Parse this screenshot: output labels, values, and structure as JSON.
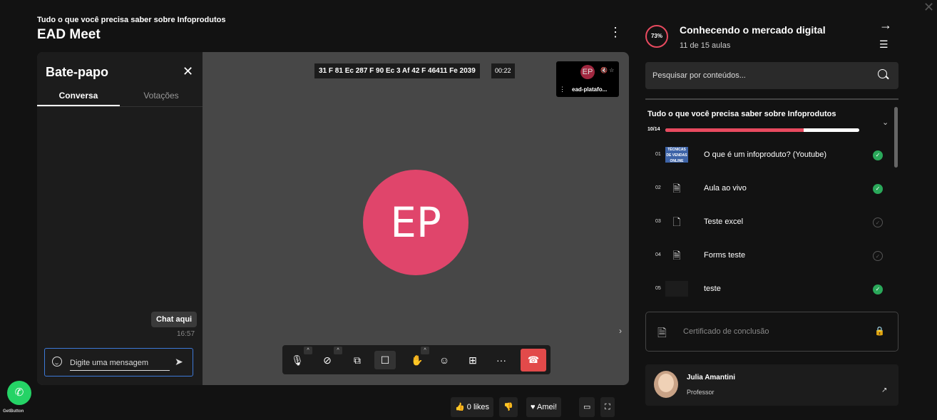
{
  "header": {
    "course_name": "Tudo o que você precisa saber sobre Infoprodutos",
    "page_title": "EAD Meet",
    "more_icon": "⋮"
  },
  "chat": {
    "title": "Bate-papo",
    "close_icon": "✕",
    "tabs": [
      {
        "label": "Conversa"
      },
      {
        "label": "Votações"
      }
    ],
    "message": {
      "text": "Chat aqui",
      "time": "16:57"
    },
    "input_placeholder": "Digite uma mensagem",
    "send_icon": "➤"
  },
  "meeting": {
    "recording_id": "31 F 81 Ec 287 F 90 Ec 3 Af 42 F 46411 Fe 2039",
    "elapsed": "00:22",
    "thumbnail": {
      "initials": "EP",
      "name": "ead-platafo..."
    },
    "main_avatar_initials": "EP",
    "side_arrow": "›",
    "toolbar": {
      "mic_icon": "🎙",
      "camera_icon": "⊘",
      "share_icon": "⧉",
      "chat_icon": "☐",
      "hand_icon": "✋",
      "participants_icon": "☺",
      "tiles_icon": "⊞",
      "more_icon": "···",
      "hangup_icon": "☎",
      "caret": "^"
    }
  },
  "actions": {
    "likes": "0 likes",
    "like_icon": "👍",
    "dislike_icon": "👎",
    "love": "Amei!",
    "love_icon": "♥",
    "theater_icon": "▭",
    "fullscreen_icon": "⛶"
  },
  "course_panel": {
    "progress_percent": "73%",
    "progress_value": 73,
    "title": "Conhecendo o mercado digital",
    "lessons_count": "11 de 15 aulas",
    "next_icon": "→",
    "filter_icon": "☰",
    "search_placeholder": "Pesquisar por conteúdos...",
    "module": {
      "title": "Tudo o que você precisa saber sobre Infoprodutos",
      "progress_label": "10/14",
      "progress_fraction": 0.714,
      "chevron": "⌄"
    },
    "lessons": [
      {
        "num": "01",
        "label": "O que é um infoproduto? (Youtube)",
        "type": "video",
        "thumb_text": "TÉCNICAS DE VENDAS ONLINE",
        "duration": "03:50",
        "done": true
      },
      {
        "num": "02",
        "label": "Aula ao vivo",
        "type": "doc",
        "done": true
      },
      {
        "num": "03",
        "label": "Teste excel",
        "type": "pdf",
        "done": false
      },
      {
        "num": "04",
        "label": "Forms teste",
        "type": "doc",
        "done": false
      },
      {
        "num": "05",
        "label": "teste",
        "type": "blank",
        "done": true
      }
    ],
    "certificate": {
      "label": "Certificado de conclusão",
      "icon": "🗎",
      "lock_icon": "🔒"
    },
    "professor": {
      "name": "Julia Amantini",
      "role": "Professor",
      "link_icon": "↗"
    }
  },
  "overlay": {
    "close_icon": "✕",
    "whatsapp_icon": "✆",
    "whatsapp_label": "GetButton"
  },
  "colors": {
    "accent": "#e84a5f",
    "avatar": "#e0456b",
    "success": "#2aa85a",
    "hangup": "#e24a4a",
    "whatsapp": "#25d366"
  }
}
